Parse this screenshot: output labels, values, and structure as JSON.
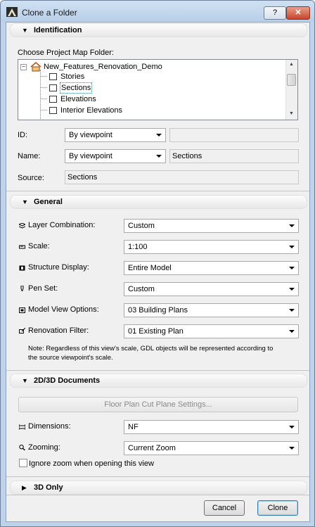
{
  "window": {
    "title": "Clone a Folder",
    "help_label": "?",
    "close_label": "✕"
  },
  "identification": {
    "header": "Identification",
    "choose_label": "Choose Project Map Folder:",
    "tree": {
      "root": "New_Features_Renovation_Demo",
      "items": [
        "Stories",
        "Sections",
        "Elevations",
        "Interior Elevations"
      ],
      "selected": "Sections"
    },
    "id_label": "ID:",
    "id_mode": "By viewpoint",
    "id_value": "",
    "name_label": "Name:",
    "name_mode": "By viewpoint",
    "name_value": "Sections",
    "source_label": "Source:",
    "source_value": "Sections"
  },
  "general": {
    "header": "General",
    "rows": [
      {
        "label": "Layer Combination:",
        "value": "Custom",
        "icon": "layers-icon"
      },
      {
        "label": "Scale:",
        "value": "1:100",
        "icon": "ruler-icon"
      },
      {
        "label": "Structure Display:",
        "value": "Entire Model",
        "icon": "structure-icon"
      },
      {
        "label": "Pen Set:",
        "value": "Custom",
        "icon": "pen-icon"
      },
      {
        "label": "Model View Options:",
        "value": "03 Building Plans",
        "icon": "model-view-icon"
      },
      {
        "label": "Renovation Filter:",
        "value": "01 Existing Plan",
        "icon": "renovation-icon"
      }
    ],
    "note_line1": "Note: Regardless of this view's scale, GDL objects will be represented according to",
    "note_line2": "the source viewpoint's scale."
  },
  "documents": {
    "header": "2D/3D Documents",
    "cut_plane_button": "Floor Plan Cut Plane Settings...",
    "dimensions_label": "Dimensions:",
    "dimensions_value": "NF",
    "zooming_label": "Zooming:",
    "zooming_value": "Current Zoom",
    "ignore_zoom_label": "Ignore zoom when opening this view",
    "ignore_zoom_checked": false
  },
  "only3d": {
    "header": "3D Only"
  },
  "footer": {
    "cancel_label": "Cancel",
    "clone_label": "Clone"
  }
}
